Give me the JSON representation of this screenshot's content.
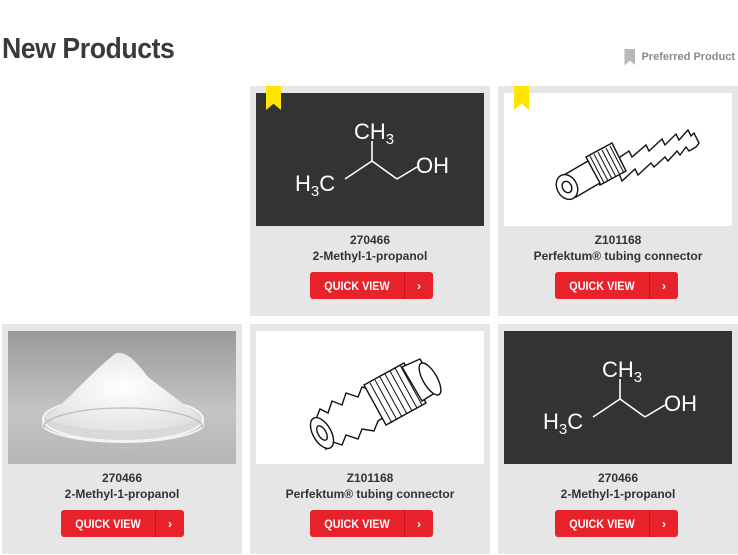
{
  "header": {
    "title": "New Products",
    "legend_label": "Preferred Product"
  },
  "colors": {
    "accent": "#e8222a",
    "preferred_flag": "#ffe600",
    "card_bg": "#e6e6e6",
    "dark_thumb": "#333333"
  },
  "products": [
    {
      "code": "270466",
      "name": "2-Methyl-1-propanol",
      "button": "QUICK VIEW",
      "button_icon": "chevron-right-icon",
      "image": "structure",
      "preferred": true
    },
    {
      "code": "Z101168",
      "name": "Perfektum® tubing connector",
      "button": "QUICK VIEW",
      "button_icon": "chevron-right-icon",
      "image": "tubing-connector",
      "preferred": true
    },
    {
      "code": "270466",
      "name": "2-Methyl-1-propanol",
      "button": "QUICK VIEW",
      "button_icon": "chevron-right-icon",
      "image": "powder-petri-dish",
      "preferred": false
    },
    {
      "code": "Z101168",
      "name": "Perfektum® tubing connector",
      "button": "QUICK VIEW",
      "button_icon": "chevron-right-icon",
      "image": "tubing-connector",
      "preferred": false
    },
    {
      "code": "270466",
      "name": "2-Methyl-1-propanol",
      "button": "QUICK VIEW",
      "button_icon": "chevron-right-icon",
      "image": "structure",
      "preferred": false
    }
  ],
  "structure_labels": {
    "ch3": "CH",
    "ch3_sub": "3",
    "h3c_h": "H",
    "h3c_sub": "3",
    "h3c_c": "C",
    "oh": "OH"
  }
}
